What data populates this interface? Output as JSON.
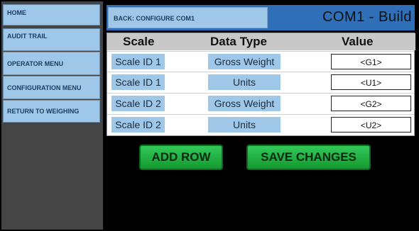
{
  "sidebar": {
    "items": [
      {
        "label": "HOME"
      },
      {
        "label": "AUDIT TRAIL"
      },
      {
        "label": "OPERATOR MENU"
      },
      {
        "label": "CONFIGURATION MENU"
      },
      {
        "label": "RETURN TO WEIGHING"
      }
    ]
  },
  "header": {
    "back_label": "BACK: CONFIGURE COM1",
    "title": "COM1 - Build"
  },
  "table": {
    "columns": [
      "Scale",
      "Data Type",
      "Value"
    ],
    "rows": [
      {
        "scale": "Scale ID 1",
        "type": "Gross Weight",
        "value": "<G1>"
      },
      {
        "scale": "Scale ID 1",
        "type": "Units",
        "value": "<U1>"
      },
      {
        "scale": "Scale ID 2",
        "type": "Gross Weight",
        "value": "<G2>"
      },
      {
        "scale": "Scale ID 2",
        "type": "Units",
        "value": "<U2>"
      }
    ]
  },
  "actions": {
    "add_row": "ADD ROW",
    "save_changes": "SAVE CHANGES"
  },
  "colors": {
    "accent_blue": "#2f6fb8",
    "button_light_blue": "#9fc7e8",
    "action_green": "#149a2f"
  }
}
